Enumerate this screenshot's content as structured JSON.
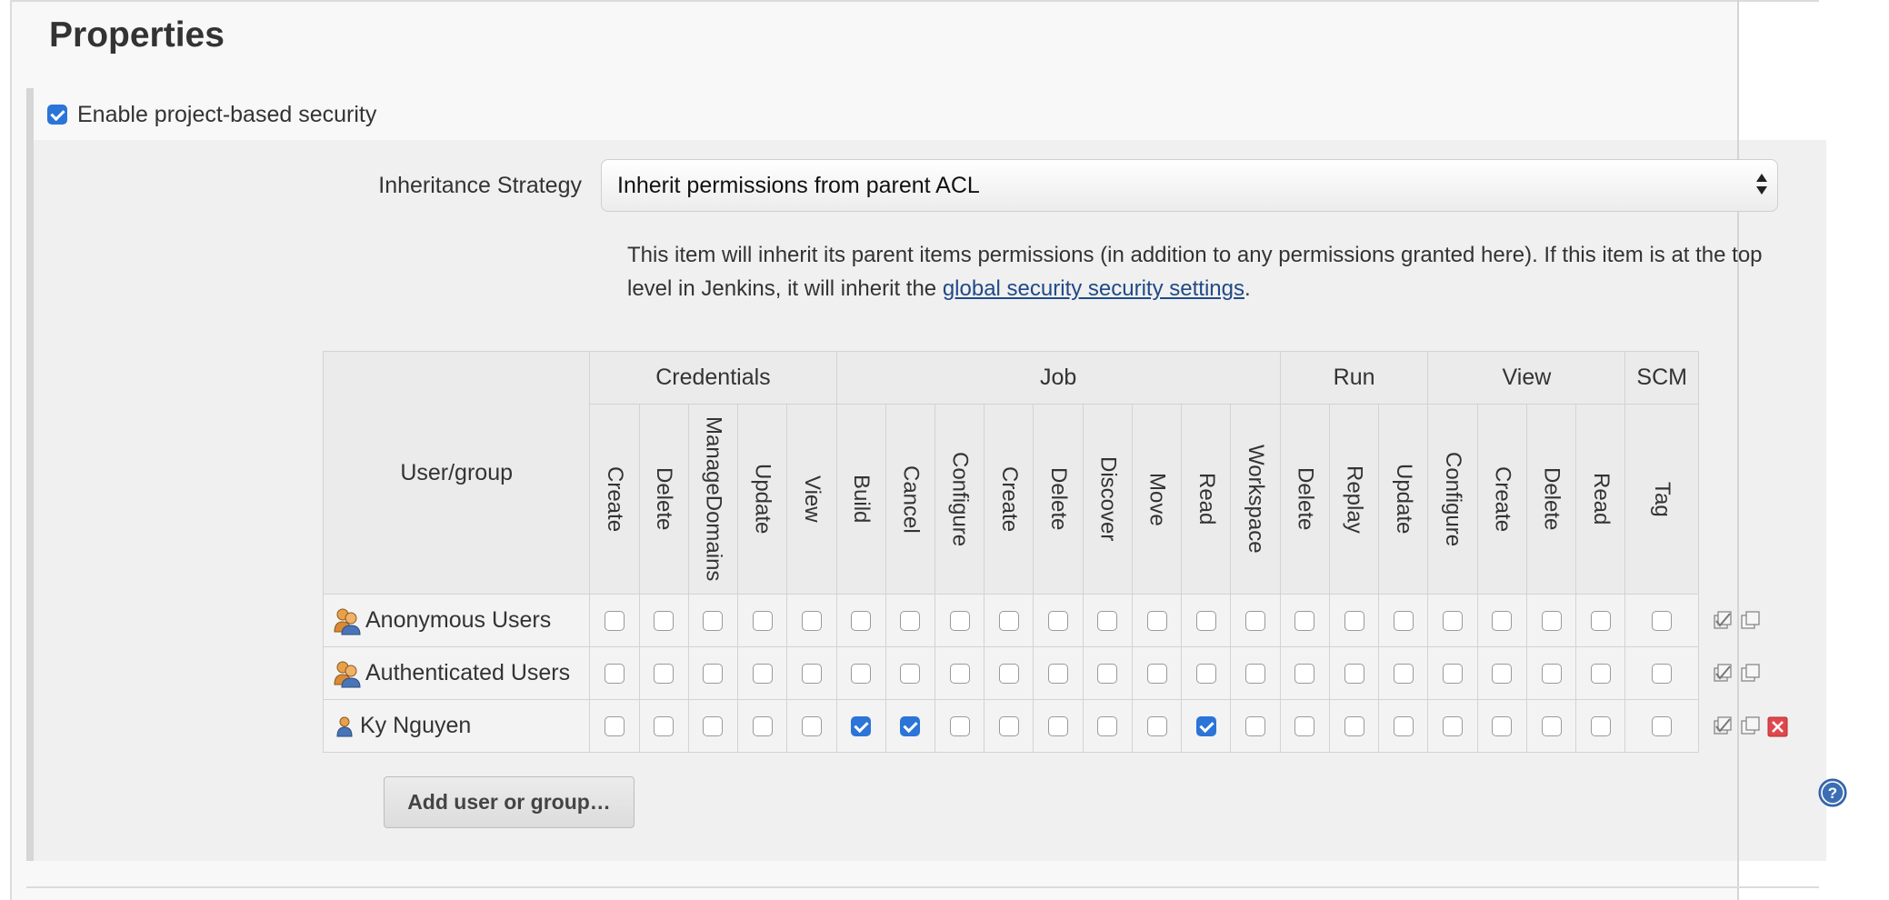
{
  "section": {
    "title": "Properties"
  },
  "enable_security": {
    "label": "Enable project-based security",
    "checked": true
  },
  "inheritance": {
    "label": "Inheritance Strategy",
    "selected": "Inherit permissions from parent ACL",
    "help_text_before": "This item will inherit its parent items permissions (in addition to any permissions granted here). If this item is at the top level in Jenkins, it will inherit the ",
    "help_link": "global security security settings",
    "help_text_after": "."
  },
  "table": {
    "usergroup_header": "User/group",
    "groups": [
      {
        "name": "Credentials",
        "perms": [
          "Create",
          "Delete",
          "ManageDomains",
          "Update",
          "View"
        ]
      },
      {
        "name": "Job",
        "perms": [
          "Build",
          "Cancel",
          "Configure",
          "Create",
          "Delete",
          "Discover",
          "Move",
          "Read",
          "Workspace"
        ]
      },
      {
        "name": "Run",
        "perms": [
          "Delete",
          "Replay",
          "Update"
        ]
      },
      {
        "name": "View",
        "perms": [
          "Configure",
          "Create",
          "Delete",
          "Read"
        ]
      },
      {
        "name": "SCM",
        "perms": [
          "Tag"
        ]
      }
    ],
    "rows": [
      {
        "name": "Anonymous Users",
        "icon": "group-icon",
        "checks": [
          false,
          false,
          false,
          false,
          false,
          false,
          false,
          false,
          false,
          false,
          false,
          false,
          false,
          false,
          false,
          false,
          false,
          false,
          false,
          false,
          false,
          false
        ],
        "actions": [
          "select-all-icon",
          "unselect-all-icon"
        ]
      },
      {
        "name": "Authenticated Users",
        "icon": "group-icon",
        "checks": [
          false,
          false,
          false,
          false,
          false,
          false,
          false,
          false,
          false,
          false,
          false,
          false,
          false,
          false,
          false,
          false,
          false,
          false,
          false,
          false,
          false,
          false
        ],
        "actions": [
          "select-all-icon",
          "unselect-all-icon"
        ]
      },
      {
        "name": "Ky Nguyen",
        "icon": "user-icon",
        "checks": [
          false,
          false,
          false,
          false,
          false,
          true,
          true,
          false,
          false,
          false,
          false,
          false,
          true,
          false,
          false,
          false,
          false,
          false,
          false,
          false,
          false,
          false
        ],
        "actions": [
          "select-all-icon",
          "unselect-all-icon",
          "remove-icon"
        ]
      }
    ]
  },
  "add_button": {
    "label": "Add user or group…"
  },
  "help_button": {
    "icon": "help-icon"
  },
  "colors": {
    "checkbox_checked": "#2b74d8",
    "link": "#204a87",
    "remove": "#e0474c"
  }
}
